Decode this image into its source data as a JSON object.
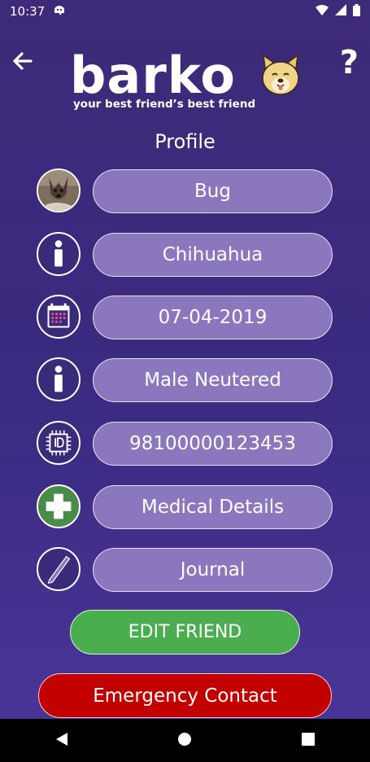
{
  "status": {
    "time": "10:37"
  },
  "header": {
    "logo_text": "barko",
    "tagline": "your best friend’s best friend",
    "help_label": "?"
  },
  "page_title": "Profile",
  "profile": {
    "name": "Bug",
    "breed": "Chihuahua",
    "birthdate": "07-04-2019",
    "sex": "Male Neutered",
    "microchip": "98100000123453",
    "medical_label": "Medical Details",
    "journal_label": "Journal"
  },
  "buttons": {
    "edit_label": "EDIT FRIEND",
    "emergency_label": "Emergency Contact"
  },
  "icons": {
    "photo": "dog-avatar",
    "breed": "info-icon",
    "birthdate": "calendar-icon",
    "sex": "info-icon",
    "microchip": "chip-id-icon",
    "medical": "medical-cross-icon",
    "journal": "pencil-icon"
  },
  "colors": {
    "background": "#3d2a78",
    "pill": "#8b77bd",
    "edit": "#4aae4f",
    "emergency": "#c20000",
    "medical_icon_bg": "#4a8a4a"
  }
}
